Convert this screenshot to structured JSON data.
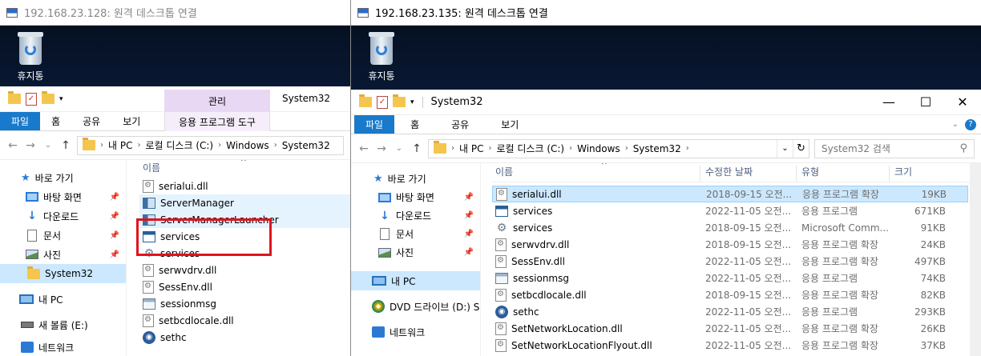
{
  "left_window": {
    "title": "192.168.23.128: 원격 데스크톱 연결",
    "recycle_bin_label": "휴지통",
    "ribbon": {
      "context_group": "관리",
      "context_tab": "응용 프로그램 도구",
      "title": "System32",
      "tabs": [
        "파일",
        "홈",
        "공유",
        "보기"
      ]
    },
    "address": [
      "내 PC",
      "로컬 디스크 (C:)",
      "Windows",
      "System32"
    ],
    "column_name": "이름",
    "nav": [
      {
        "label": "바로 가기"
      },
      {
        "label": "바탕 화면"
      },
      {
        "label": "다운로드"
      },
      {
        "label": "문서"
      },
      {
        "label": "사진"
      },
      {
        "label": "System32"
      },
      {
        "label": "내 PC"
      },
      {
        "label": "새 볼륨 (E:)"
      },
      {
        "label": "네트워크"
      }
    ],
    "files": [
      {
        "name": "serialui.dll",
        "icon": "dll-icon"
      },
      {
        "name": "ServerManager",
        "icon": "server-manager-icon"
      },
      {
        "name": "ServerManagerLauncher",
        "icon": "server-manager-icon"
      },
      {
        "name": "services",
        "icon": "msc-icon"
      },
      {
        "name": "services",
        "icon": "gear-icon"
      },
      {
        "name": "serwvdrv.dll",
        "icon": "dll-icon"
      },
      {
        "name": "SessEnv.dll",
        "icon": "dll-icon"
      },
      {
        "name": "sessionmsg",
        "icon": "exe-icon"
      },
      {
        "name": "setbcdlocale.dll",
        "icon": "dll-icon"
      },
      {
        "name": "sethc",
        "icon": "sethc-icon"
      }
    ]
  },
  "right_window": {
    "title": "192.168.23.135: 원격 데스크톱 연결",
    "recycle_bin_label": "휴지통",
    "explorer_title": "System32",
    "window_controls": {
      "minimize": "—",
      "maximize": "☐",
      "close": "✕"
    },
    "ribbon": {
      "tabs": [
        "파일",
        "홈",
        "공유",
        "보기"
      ]
    },
    "address": [
      "내 PC",
      "로컬 디스크 (C:)",
      "Windows",
      "System32"
    ],
    "search_placeholder": "System32 검색",
    "columns": {
      "name": "이름",
      "modified": "수정한 날짜",
      "type": "유형",
      "size": "크기"
    },
    "nav": [
      {
        "label": "바로 가기"
      },
      {
        "label": "바탕 화면"
      },
      {
        "label": "다운로드"
      },
      {
        "label": "문서"
      },
      {
        "label": "사진"
      },
      {
        "label": "내 PC"
      },
      {
        "label": "DVD 드라이브 (D:) S"
      },
      {
        "label": "네트워크"
      }
    ],
    "files": [
      {
        "name": "serialui.dll",
        "modified": "2018-09-15 오전...",
        "type": "응용 프로그램 확장",
        "size": "19KB",
        "icon": "dll-icon"
      },
      {
        "name": "services",
        "modified": "2022-11-05 오전...",
        "type": "응용 프로그램",
        "size": "671KB",
        "icon": "msc-icon"
      },
      {
        "name": "services",
        "modified": "2018-09-15 오전...",
        "type": "Microsoft Comm...",
        "size": "91KB",
        "icon": "gear-icon"
      },
      {
        "name": "serwvdrv.dll",
        "modified": "2018-09-15 오전...",
        "type": "응용 프로그램 확장",
        "size": "24KB",
        "icon": "dll-icon"
      },
      {
        "name": "SessEnv.dll",
        "modified": "2022-11-05 오전...",
        "type": "응용 프로그램 확장",
        "size": "497KB",
        "icon": "dll-icon"
      },
      {
        "name": "sessionmsg",
        "modified": "2022-11-05 오전...",
        "type": "응용 프로그램",
        "size": "74KB",
        "icon": "exe-icon"
      },
      {
        "name": "setbcdlocale.dll",
        "modified": "2018-09-15 오전...",
        "type": "응용 프로그램 확장",
        "size": "82KB",
        "icon": "dll-icon"
      },
      {
        "name": "sethc",
        "modified": "2022-11-05 오전...",
        "type": "응용 프로그램",
        "size": "293KB",
        "icon": "sethc-icon"
      },
      {
        "name": "SetNetworkLocation.dll",
        "modified": "2022-11-05 오전...",
        "type": "응용 프로그램 확장",
        "size": "26KB",
        "icon": "dll-icon"
      },
      {
        "name": "SetNetworkLocationFlyout.dll",
        "modified": "2022-11-05 오전...",
        "type": "응용 프로그램 확장",
        "size": "37KB",
        "icon": "dll-icon"
      }
    ]
  },
  "colors": {
    "file_tab": "#1979ca",
    "context_tab": "#e9d8f3",
    "selection": "#cce8ff",
    "highlight_box": "#e0141f"
  }
}
